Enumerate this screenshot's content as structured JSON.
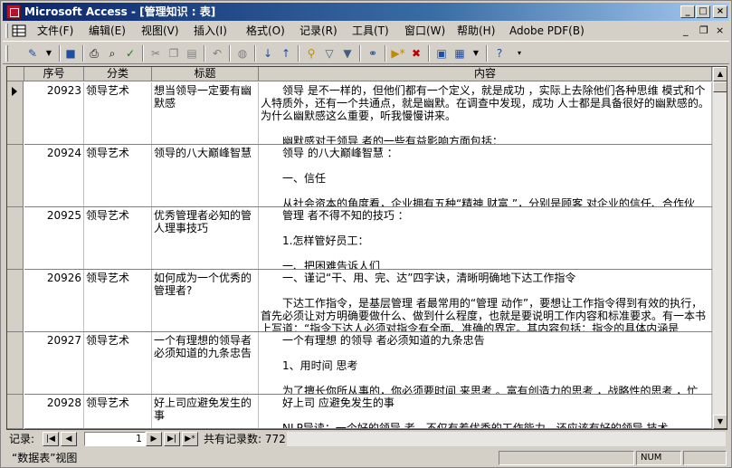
{
  "window": {
    "title": "Microsoft Access - [管理知识 : 表]",
    "min": "_",
    "max": "□",
    "close": "×"
  },
  "menu": {
    "items": [
      "文件(F)",
      "编辑(E)",
      "视图(V)",
      "插入(I)",
      "格式(O)",
      "记录(R)",
      "工具(T)",
      "窗口(W)",
      "帮助(H)",
      "Adobe PDF(B)"
    ],
    "mdi_min": "_",
    "mdi_restore": "❐",
    "mdi_close": "×"
  },
  "table": {
    "columns": [
      "序号",
      "分类",
      "标题",
      "内容"
    ],
    "rows": [
      {
        "id": "20923",
        "category": "领导艺术",
        "title": "想当领导一定要有幽默感",
        "content": [
          "　　领导 是不一样的，但他们都有一个定义，就是成功 ，实际上去除他们各种思维 模式和个人特质外，还有一个共通点，就是幽默。在调查中发现，成功 人士都是具备很好的幽默感的。为什么幽默感这么重要，听我慢慢讲来。",
          "",
          "　　幽默感对于领导 者的一些有益影响方面包括："
        ]
      },
      {
        "id": "20924",
        "category": "领导艺术",
        "title": "领导的八大巅峰智慧",
        "content": [
          "　　领导 的八大巅峰智慧 ：",
          "",
          "　　一、信任",
          "",
          "　　从社会资本的角度看，企业拥有五种“精神 财富 ”，分别是顾客 对企业的信任、合作伙"
        ]
      },
      {
        "id": "20925",
        "category": "领导艺术",
        "title": "优秀管理者必知的管人理事技巧",
        "content": [
          "　　管理 者不得不知的技巧 ：",
          "",
          "　　1.怎样管好员工：",
          "",
          "　　一、把困难告诉人们"
        ]
      },
      {
        "id": "20926",
        "category": "领导艺术",
        "title": "如何成为一个优秀的管理者?",
        "content": [
          "　　一、谨记“干、用、完、达”四字诀，清晰明确地下达工作指令",
          "",
          "　　下达工作指令，是基层管理 者最常用的“管理 动作”，要想让工作指令得到有效的执行，首先必须让对方明确要做什么、做到什么程度，也就是要说明工作内容和标准要求。有一本书上写道：“指令下达人必须对指令有全面、准确的界定。其内容包括：指令的具体内涵是"
        ]
      },
      {
        "id": "20927",
        "category": "领导艺术",
        "title": "一个有理想的领导者必须知道的九条忠告",
        "content": [
          "　　一个有理想 的领导 者必须知道的九条忠告",
          "",
          "　　1、用时间 思考",
          "",
          "　　为了擅长你所从事的，你必须要时间 来思考 。富有创造力的思考 ，战略性的思考 ，忙"
        ]
      },
      {
        "id": "20928",
        "category": "领导艺术",
        "title": "好上司应避免发生的事",
        "content": [
          "　　好上司 应避免发生的事",
          "",
          "　　NLP导读：一个好的领导 者，不仅有着优秀的工作能力，还应该有好的领导 技术。"
        ]
      }
    ]
  },
  "nav": {
    "label": "记录:",
    "first": "|◀",
    "prev": "◀",
    "next": "▶",
    "last": "▶|",
    "new": "▶*",
    "current": "1",
    "total_label": "共有记录数: 7721"
  },
  "status": {
    "text": "“数据表”视图",
    "num": "NUM"
  }
}
